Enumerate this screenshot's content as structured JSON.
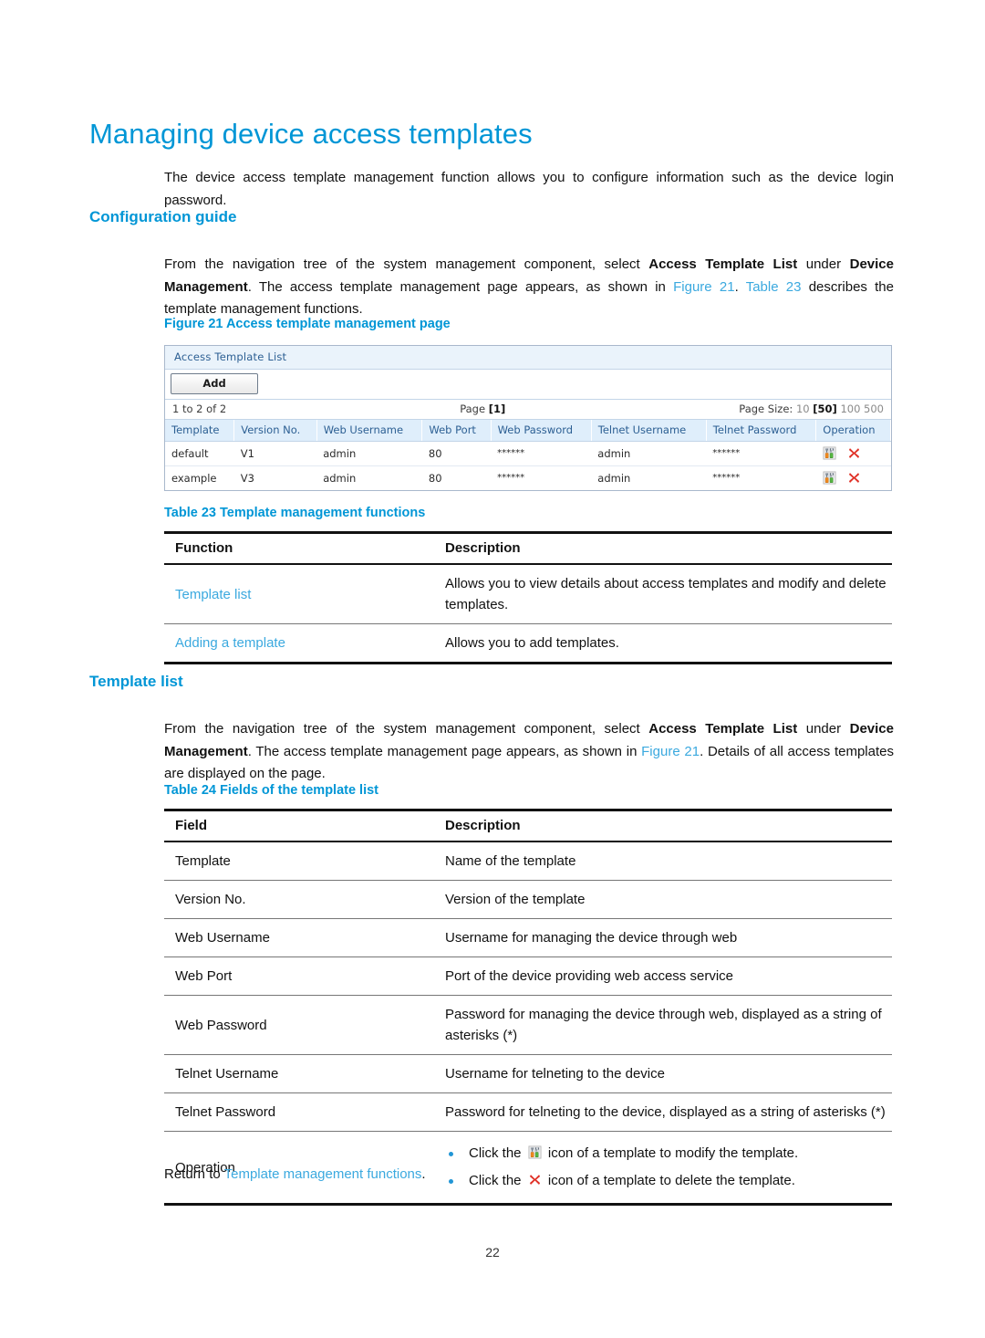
{
  "document": {
    "title": "Managing device access templates",
    "page_number": "22"
  },
  "intro": {
    "text": "The device access template management function allows you to configure information such as the device login password."
  },
  "config_guide": {
    "heading": "Configuration guide",
    "p_part1": "From the navigation tree of the system management component, select ",
    "p_bold1": "Access Template List",
    "p_part2": " under ",
    "p_bold2": "Device Management",
    "p_part3": ". The access template management page appears, as shown in ",
    "p_link1": "Figure 21",
    "p_part4": ". ",
    "p_link2": "Table 23",
    "p_part5": " describes the template management functions."
  },
  "figure21": {
    "caption": "Figure 21 Access template management page",
    "screenshot": {
      "panel_title": "Access Template List",
      "add_button": "Add",
      "pagination": {
        "range": "1 to 2 of 2",
        "page_label": "Page",
        "page_current": "1",
        "page_size_label": "Page Size:",
        "sizes": [
          "10",
          "50",
          "100",
          "500"
        ],
        "selected_size": "50"
      },
      "columns": [
        "Template",
        "Version No.",
        "Web Username",
        "Web Port",
        "Web Password",
        "Telnet Username",
        "Telnet Password",
        "Operation"
      ],
      "rows": [
        {
          "template": "default",
          "version": "V1",
          "web_username": "admin",
          "web_port": "80",
          "web_password": "******",
          "telnet_username": "admin",
          "telnet_password": "******",
          "modify_icon": "modify-icon",
          "delete_icon": "delete-icon"
        },
        {
          "template": "example",
          "version": "V3",
          "web_username": "admin",
          "web_port": "80",
          "web_password": "******",
          "telnet_username": "admin",
          "telnet_password": "******",
          "modify_icon": "modify-icon",
          "delete_icon": "delete-icon"
        }
      ]
    }
  },
  "table23": {
    "caption": "Table 23 Template management functions",
    "headers": [
      "Function",
      "Description"
    ],
    "rows": [
      {
        "function": "Template list",
        "description": "Allows you to view details about access templates and modify and delete templates."
      },
      {
        "function": "Adding a template",
        "description": "Allows you to add templates."
      }
    ]
  },
  "template_list": {
    "heading": "Template list",
    "p_part1": "From the navigation tree of the system management component, select ",
    "p_bold1": "Access Template List",
    "p_part2": " under ",
    "p_bold2": "Device Management",
    "p_part3": ". The access template management page appears, as shown in ",
    "p_link1": "Figure 21",
    "p_part4": ". Details of all access templates are displayed on the page."
  },
  "table24": {
    "caption": "Table 24 Fields of the template list",
    "headers": [
      "Field",
      "Description"
    ],
    "rows": [
      {
        "field": "Template",
        "description": "Name of the template"
      },
      {
        "field": "Version No.",
        "description": "Version of the template"
      },
      {
        "field": "Web Username",
        "description": "Username for managing the device through web"
      },
      {
        "field": "Web Port",
        "description": "Port of the device providing web access service"
      },
      {
        "field": "Web Password",
        "description": "Password for managing the device through web, displayed as a string of asterisks (*)"
      },
      {
        "field": "Telnet Username",
        "description": "Username for telneting to the device"
      },
      {
        "field": "Telnet Password",
        "description": "Password for telneting to the device, displayed as a string of asterisks (*)"
      }
    ],
    "operation_row": {
      "field": "Operation",
      "bullet1_before": "Click the ",
      "bullet1_after": " icon of a template to modify the template.",
      "bullet2_before": "Click the ",
      "bullet2_after": " icon of a template to delete the template."
    }
  },
  "footer": {
    "return_before": "Return to ",
    "return_link": "Template management functions",
    "return_after": "."
  },
  "colors": {
    "heading_blue": "#0096D6",
    "link_blue": "#3BA9DF",
    "panel_header_bg": "#EAF3FB",
    "table_header_bg": "#DFEEFB",
    "delete_icon_red": "#E03127",
    "modify_icon_orange": "#F08A1E",
    "modify_icon_green": "#57B842"
  }
}
